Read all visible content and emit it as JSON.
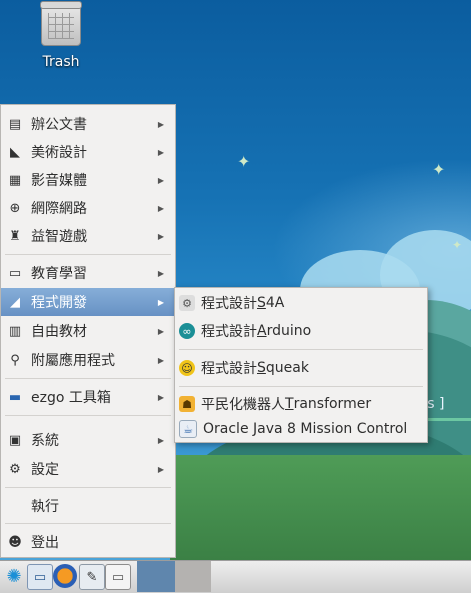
{
  "desktop": {
    "trash_label": "Trash",
    "wallpaper_text": "ss ]"
  },
  "main_menu": {
    "items": [
      {
        "label": "辦公文書",
        "icon": "document-icon",
        "has_submenu": true
      },
      {
        "label": "美術設計",
        "icon": "graphics-icon",
        "has_submenu": true
      },
      {
        "label": "影音媒體",
        "icon": "film-icon",
        "has_submenu": true
      },
      {
        "label": "網際網路",
        "icon": "globe-icon",
        "has_submenu": true
      },
      {
        "label": "益智遊戲",
        "icon": "game-icon",
        "has_submenu": true
      },
      {
        "label": "教育學習",
        "icon": "book-icon",
        "has_submenu": true
      },
      {
        "label": "程式開發",
        "icon": "development-icon",
        "has_submenu": true,
        "active": true
      },
      {
        "label": "自由教材",
        "icon": "books-icon",
        "has_submenu": true
      },
      {
        "label": "附屬應用程式",
        "icon": "accessories-icon",
        "has_submenu": true
      },
      {
        "label": "ezgo 工具箱",
        "icon": "toolbox-icon",
        "has_submenu": true
      },
      {
        "label": "系統",
        "icon": "monitor-icon",
        "has_submenu": true
      },
      {
        "label": "設定",
        "icon": "gear-icon",
        "has_submenu": true
      },
      {
        "label": "執行",
        "icon": "",
        "has_submenu": false
      },
      {
        "label": "登出",
        "icon": "logout-icon",
        "has_submenu": false
      }
    ]
  },
  "submenu": {
    "items": [
      {
        "prefix": "程式設計",
        "mnemonic": "S",
        "rest": "4A",
        "icon": "s4a-icon"
      },
      {
        "prefix": "程式設計",
        "mnemonic": "A",
        "rest": "rduino",
        "icon": "arduino-icon"
      },
      {
        "prefix": "程式設計",
        "mnemonic": "S",
        "rest": "queak",
        "icon": "squeak-icon"
      },
      {
        "prefix": "平民化機器人",
        "mnemonic": "T",
        "rest": "ransformer",
        "icon": "robot-icon"
      },
      {
        "prefix": "Oracle Java 8 Mission Control",
        "mnemonic": "",
        "rest": "",
        "icon": "java-icon"
      }
    ]
  },
  "taskbar": {
    "buttons": [
      "start-menu-icon",
      "file-manager-icon",
      "firefox-icon",
      "settings-tool-icon",
      "terminal-icon"
    ]
  },
  "colors": {
    "menu_bg": "#f2f1f0",
    "active_item": "#6791c4",
    "desktop_bg": "#1672b4"
  }
}
